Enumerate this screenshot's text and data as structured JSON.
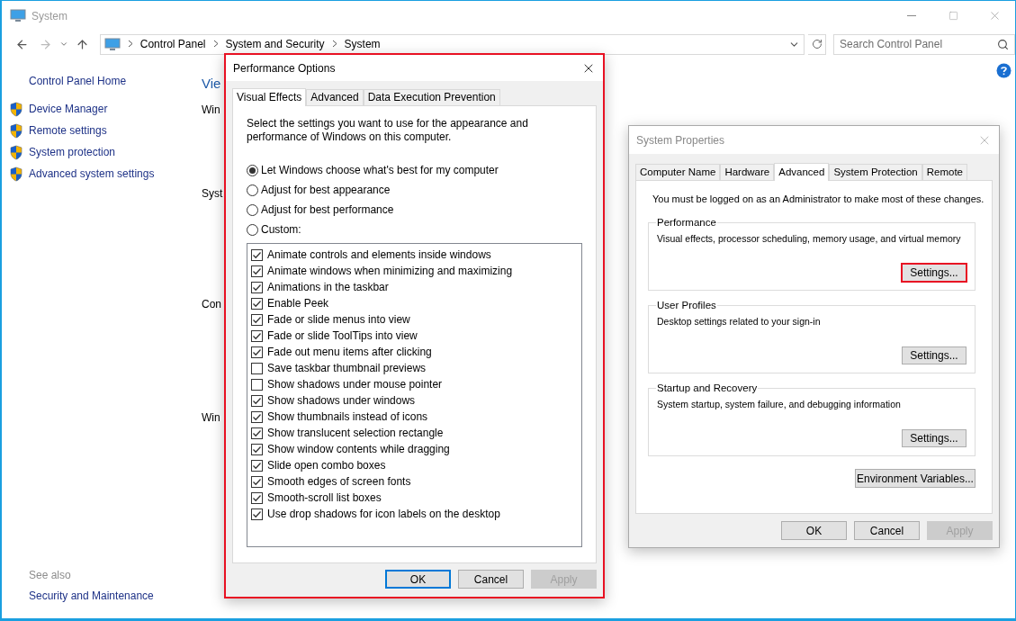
{
  "window": {
    "title": "System"
  },
  "address_bar": {
    "path": [
      "Control Panel",
      "System and Security",
      "System"
    ]
  },
  "search": {
    "placeholder": "Search Control Panel"
  },
  "sidebar": {
    "home": "Control Panel Home",
    "items": [
      {
        "label": "Device Manager"
      },
      {
        "label": "Remote settings"
      },
      {
        "label": "System protection"
      },
      {
        "label": "Advanced system settings"
      }
    ],
    "see_also": {
      "heading": "See also",
      "links": [
        "Security and Maintenance"
      ]
    }
  },
  "main": {
    "title": "Vie",
    "headings": [
      "Win",
      "Syst",
      "Con",
      "Win"
    ]
  },
  "performance_options": {
    "title": "Performance Options",
    "highlighted": true,
    "tabs": [
      {
        "label": "Visual Effects",
        "selected": true
      },
      {
        "label": "Advanced",
        "selected": false
      },
      {
        "label": "Data Execution Prevention",
        "selected": false
      }
    ],
    "description": "Select the settings you want to use for the appearance and performance of Windows on this computer.",
    "radios": [
      {
        "label": "Let Windows choose what's best for my computer",
        "selected": true
      },
      {
        "label": "Adjust for best appearance",
        "selected": false
      },
      {
        "label": "Adjust for best performance",
        "selected": false
      },
      {
        "label": "Custom:",
        "selected": false
      }
    ],
    "checkboxes": [
      {
        "label": "Animate controls and elements inside windows",
        "checked": true
      },
      {
        "label": "Animate windows when minimizing and maximizing",
        "checked": true
      },
      {
        "label": "Animations in the taskbar",
        "checked": true
      },
      {
        "label": "Enable Peek",
        "checked": true
      },
      {
        "label": "Fade or slide menus into view",
        "checked": true
      },
      {
        "label": "Fade or slide ToolTips into view",
        "checked": true
      },
      {
        "label": "Fade out menu items after clicking",
        "checked": true
      },
      {
        "label": "Save taskbar thumbnail previews",
        "checked": false
      },
      {
        "label": "Show shadows under mouse pointer",
        "checked": false
      },
      {
        "label": "Show shadows under windows",
        "checked": true
      },
      {
        "label": "Show thumbnails instead of icons",
        "checked": true
      },
      {
        "label": "Show translucent selection rectangle",
        "checked": true
      },
      {
        "label": "Show window contents while dragging",
        "checked": true
      },
      {
        "label": "Slide open combo boxes",
        "checked": true
      },
      {
        "label": "Smooth edges of screen fonts",
        "checked": true
      },
      {
        "label": "Smooth-scroll list boxes",
        "checked": true
      },
      {
        "label": "Use drop shadows for icon labels on the desktop",
        "checked": true
      }
    ],
    "buttons": [
      {
        "label": "OK",
        "default": true,
        "disabled": false
      },
      {
        "label": "Cancel",
        "default": false,
        "disabled": false
      },
      {
        "label": "Apply",
        "default": false,
        "disabled": true
      }
    ]
  },
  "system_properties": {
    "title": "System Properties",
    "active": false,
    "tabs": [
      {
        "label": "Computer Name",
        "selected": false
      },
      {
        "label": "Hardware",
        "selected": false
      },
      {
        "label": "Advanced",
        "selected": true
      },
      {
        "label": "System Protection",
        "selected": false
      },
      {
        "label": "Remote",
        "selected": false
      }
    ],
    "notice": "You must be logged on as an Administrator to make most of these changes.",
    "groups": [
      {
        "title": "Performance",
        "description": "Visual effects, processor scheduling, memory usage, and virtual memory",
        "button": {
          "label": "Settings...",
          "highlighted": true
        }
      },
      {
        "title": "User Profiles",
        "description": "Desktop settings related to your sign-in",
        "button": {
          "label": "Settings...",
          "highlighted": false
        }
      },
      {
        "title": "Startup and Recovery",
        "description": "System startup, system failure, and debugging information",
        "button": {
          "label": "Settings...",
          "highlighted": false
        }
      }
    ],
    "environment_button": "Environment Variables...",
    "buttons": [
      {
        "label": "OK",
        "default": false,
        "disabled": false
      },
      {
        "label": "Cancel",
        "default": false,
        "disabled": false
      },
      {
        "label": "Apply",
        "default": false,
        "disabled": true
      }
    ]
  }
}
